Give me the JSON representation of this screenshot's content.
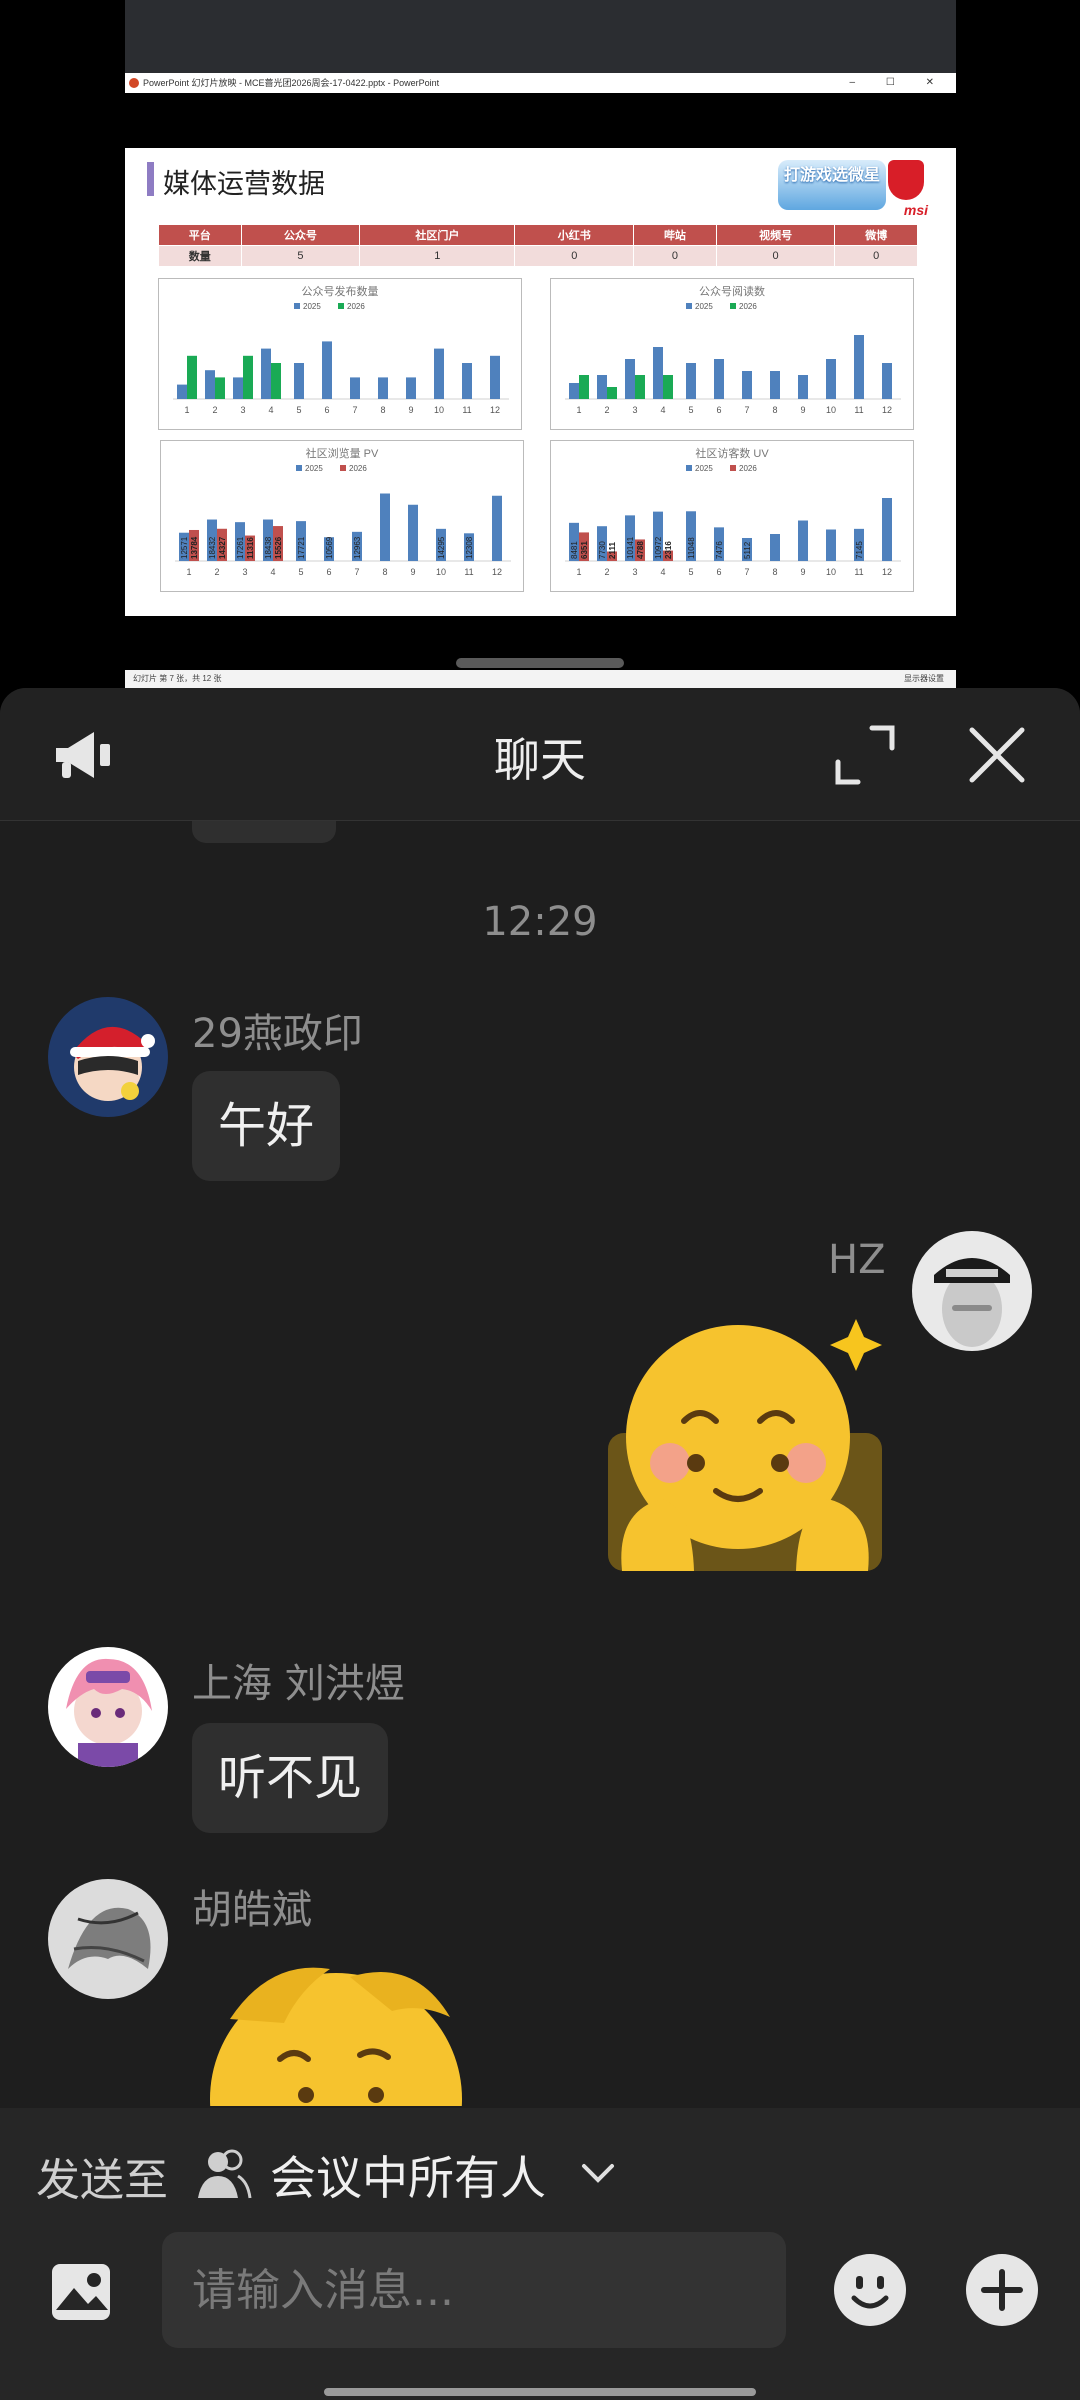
{
  "shared_screen": {
    "window_title": "PowerPoint 幻灯片放映 - MCE蔷光团2026周会-17-0422.pptx - PowerPoint",
    "window_controls": "– ☐ ✕",
    "slide_title": "媒体运营数据",
    "logo_text": "打游戏选微星",
    "brand_text": "msi",
    "table": {
      "headers": [
        "平台",
        "公众号",
        "社区门户",
        "小红书",
        "哔站",
        "视频号",
        "微博"
      ],
      "row_label": "数量",
      "values": [
        "5",
        "1",
        "0",
        "0",
        "0",
        "0"
      ]
    },
    "status_left": "幻灯片 第 7 张，共 12 张",
    "status_right": "显示器设置"
  },
  "chart_data": [
    {
      "type": "bar",
      "title": "公众号发布数量",
      "categories": [
        "1",
        "2",
        "3",
        "4",
        "5",
        "6",
        "7",
        "8",
        "9",
        "10",
        "11",
        "12"
      ],
      "series": [
        {
          "name": "2025",
          "color": "#4f81bd",
          "values": [
            2,
            4,
            3,
            7,
            5,
            8,
            3,
            3,
            3,
            7,
            5,
            6
          ]
        },
        {
          "name": "2026",
          "color": "#1aaa55",
          "values": [
            6,
            3,
            6,
            5,
            null,
            null,
            null,
            null,
            null,
            null,
            null,
            null
          ]
        }
      ],
      "ylim": [
        0,
        10
      ]
    },
    {
      "type": "bar",
      "title": "公众号阅读数",
      "categories": [
        "1",
        "2",
        "3",
        "4",
        "5",
        "6",
        "7",
        "8",
        "9",
        "10",
        "11",
        "12"
      ],
      "series": [
        {
          "name": "2025",
          "color": "#4f81bd",
          "values": [
            4,
            6,
            10,
            13,
            9,
            10,
            7,
            7,
            6,
            10,
            16,
            9
          ]
        },
        {
          "name": "2026",
          "color": "#1aaa55",
          "values": [
            6,
            3,
            6,
            6,
            null,
            null,
            null,
            null,
            null,
            null,
            null,
            null
          ]
        }
      ],
      "ylim": [
        0,
        18
      ]
    },
    {
      "type": "bar",
      "title": "社区浏览量 PV",
      "categories": [
        "1",
        "2",
        "3",
        "4",
        "5",
        "6",
        "7",
        "8",
        "9",
        "10",
        "11",
        "12"
      ],
      "series": [
        {
          "name": "2025",
          "color": "#4f81bd",
          "values": [
            12571,
            18432,
            17261,
            18438,
            17721,
            10569,
            12963,
            30000,
            25000,
            14295,
            12308,
            29000
          ]
        },
        {
          "name": "2026",
          "color": "#c0504d",
          "values": [
            13784,
            14327,
            11316,
            15526,
            null,
            null,
            null,
            null,
            null,
            null,
            null,
            null
          ]
        }
      ],
      "labels": [
        "12571",
        "13784",
        "18432",
        "14327",
        "17261",
        "11316",
        "18438",
        "15526",
        "17721",
        "10569",
        "12963",
        "",
        "",
        "14295",
        "12308",
        ""
      ],
      "ylim": [
        0,
        32000
      ]
    },
    {
      "type": "bar",
      "title": "社区访客数 UV",
      "categories": [
        "1",
        "2",
        "3",
        "4",
        "5",
        "6",
        "7",
        "8",
        "9",
        "10",
        "11",
        "12"
      ],
      "series": [
        {
          "name": "2025",
          "color": "#4f81bd",
          "values": [
            8481,
            7730,
            10141,
            10972,
            11048,
            7476,
            5112,
            6000,
            9000,
            7000,
            7145,
            14000
          ]
        },
        {
          "name": "2026",
          "color": "#c0504d",
          "values": [
            6351,
            2111,
            4788,
            2316,
            null,
            null,
            null,
            null,
            null,
            null,
            null,
            null
          ]
        }
      ],
      "labels": [
        "8481",
        "6351",
        "7730",
        "2111",
        "10141",
        "4788",
        "10972",
        "2316",
        "11048",
        "7476",
        "5112",
        "",
        "",
        "",
        "7145",
        ""
      ],
      "ylim": [
        0,
        16000
      ]
    }
  ],
  "chat": {
    "title": "聊天",
    "time_separator": "12:29",
    "messages": [
      {
        "sender": "29燕政印",
        "text": "午好"
      },
      {
        "sender": "HZ",
        "text": ""
      },
      {
        "sender": "上海 刘洪煜",
        "text": "听不见"
      },
      {
        "sender": "胡皓斌",
        "text": ""
      }
    ]
  },
  "composer": {
    "send_to_label": "发送至",
    "audience": "会议中所有人",
    "placeholder": "请输入消息..."
  },
  "icons": {
    "announce": "megaphone-icon",
    "expand": "expand-icon",
    "close": "close-icon",
    "people": "people-icon",
    "chevron": "chevron-down-icon",
    "image": "image-icon",
    "emoji": "emoji-icon",
    "plus": "plus-icon"
  }
}
